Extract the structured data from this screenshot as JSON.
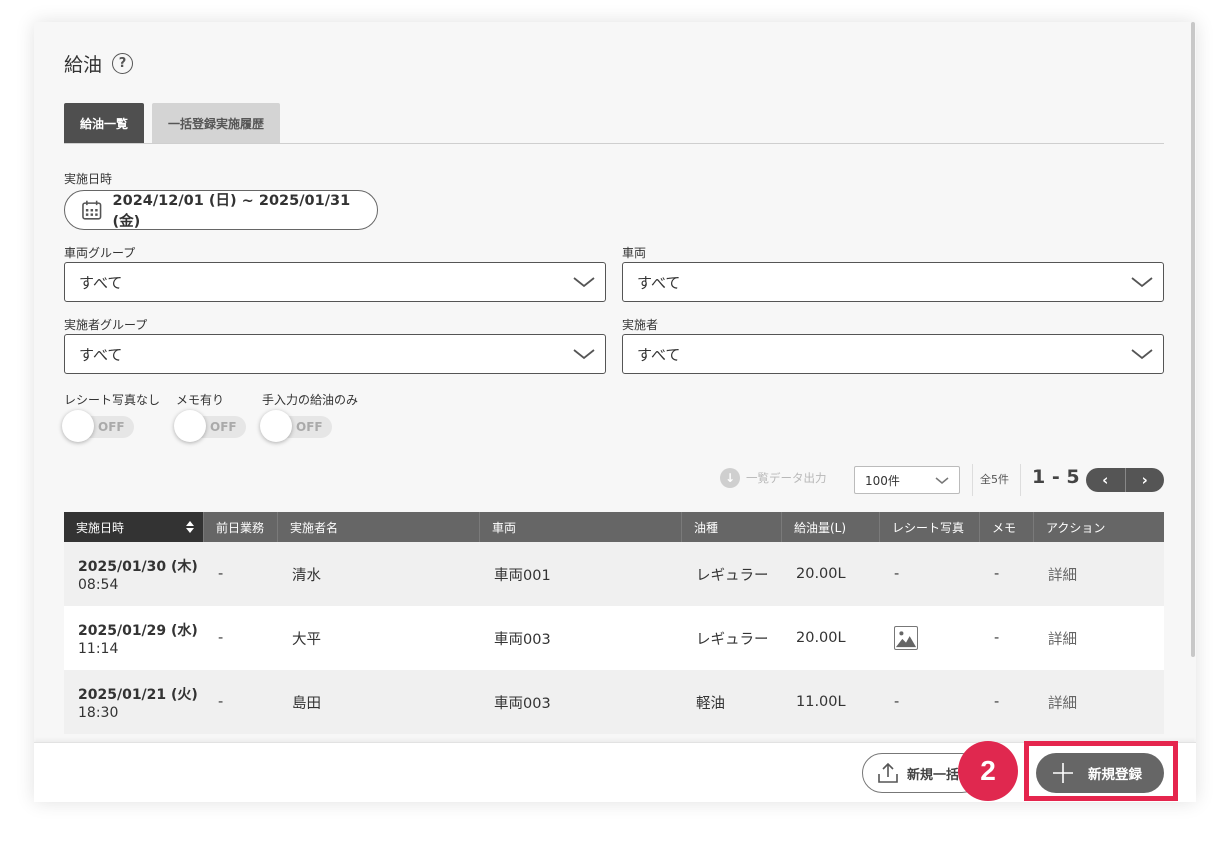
{
  "page": {
    "title": "給油"
  },
  "tabs": [
    {
      "label": "給油一覧",
      "active": true
    },
    {
      "label": "一括登録実施履歴",
      "active": false
    }
  ],
  "filters": {
    "date_label": "実施日時",
    "date_range": "2024/12/01 (日) ~ 2025/01/31 (金)",
    "vehicle_group": {
      "label": "車両グループ",
      "value": "すべて"
    },
    "vehicle": {
      "label": "車両",
      "value": "すべて"
    },
    "operator_group": {
      "label": "実施者グループ",
      "value": "すべて"
    },
    "operator": {
      "label": "実施者",
      "value": "すべて"
    }
  },
  "toggles": [
    {
      "label": "レシート写真なし",
      "state": "OFF"
    },
    {
      "label": "メモ有り",
      "state": "OFF"
    },
    {
      "label": "手入力の給油のみ",
      "state": "OFF"
    }
  ],
  "toolbar": {
    "export_label": "一覧データ出力",
    "per_page": "100件",
    "total": "全5件",
    "range": "1 - 5",
    "prev": "‹",
    "next": "›"
  },
  "table": {
    "columns": [
      "実施日時",
      "前日業務",
      "実施者名",
      "車両",
      "油種",
      "給油量(L)",
      "レシート写真",
      "メモ",
      "アクション"
    ],
    "rows": [
      {
        "date": "2025/01/30 (木)",
        "time": "08:54",
        "prev_work": "-",
        "operator": "清水",
        "vehicle": "車両001",
        "fuel": "レギュラー",
        "amount": "20.00L",
        "receipt": "-",
        "memo": "-",
        "action": "詳細"
      },
      {
        "date": "2025/01/29 (水)",
        "time": "11:14",
        "prev_work": "-",
        "operator": "大平",
        "vehicle": "車両003",
        "fuel": "レギュラー",
        "amount": "20.00L",
        "receipt": "photo-icon",
        "memo": "-",
        "action": "詳細"
      },
      {
        "date": "2025/01/21 (火)",
        "time": "18:30",
        "prev_work": "-",
        "operator": "島田",
        "vehicle": "車両003",
        "fuel": "軽油",
        "amount": "11.00L",
        "receipt": "-",
        "memo": "-",
        "action": "詳細"
      }
    ]
  },
  "footer": {
    "bulk_label": "新規一括",
    "new_label": "新規登録"
  },
  "annotation": {
    "step": "2",
    "color": "#e5254d"
  }
}
